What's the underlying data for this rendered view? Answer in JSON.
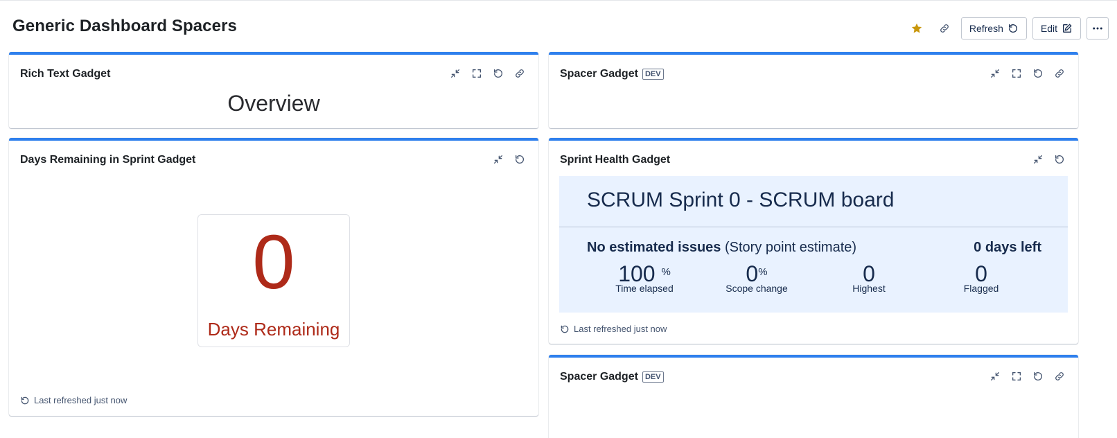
{
  "header": {
    "title": "Generic Dashboard Spacers",
    "refresh_label": "Refresh",
    "edit_label": "Edit",
    "star_color": "#c9970c"
  },
  "gadgets": {
    "rich_text": {
      "title": "Rich Text Gadget",
      "content": "Overview"
    },
    "spacer_1": {
      "title": "Spacer Gadget",
      "badge": "DEV"
    },
    "days_remaining": {
      "title": "Days Remaining in Sprint Gadget",
      "number": "0",
      "label": "Days Remaining",
      "refreshed": "Last refreshed just now"
    },
    "sprint_health": {
      "title": "Sprint Health Gadget",
      "sprint_name": "SCRUM Sprint 0 - SCRUM board",
      "estimate_bold": "No estimated issues",
      "estimate_rest": "(Story point estimate)",
      "days_left": "0 days left",
      "stats": [
        {
          "value": "100",
          "unit": "%",
          "label": "Time elapsed"
        },
        {
          "value": "0",
          "unit": "%",
          "label": "Scope change"
        },
        {
          "value": "0",
          "unit": "",
          "label": "Highest"
        },
        {
          "value": "0",
          "unit": "",
          "label": "Flagged"
        }
      ],
      "refreshed": "Last refreshed just now"
    },
    "spacer_2": {
      "title": "Spacer Gadget",
      "badge": "DEV"
    }
  },
  "colors": {
    "accent": "#2f80ed",
    "danger": "#ae2a19",
    "health_bg": "#e9f2ff"
  }
}
